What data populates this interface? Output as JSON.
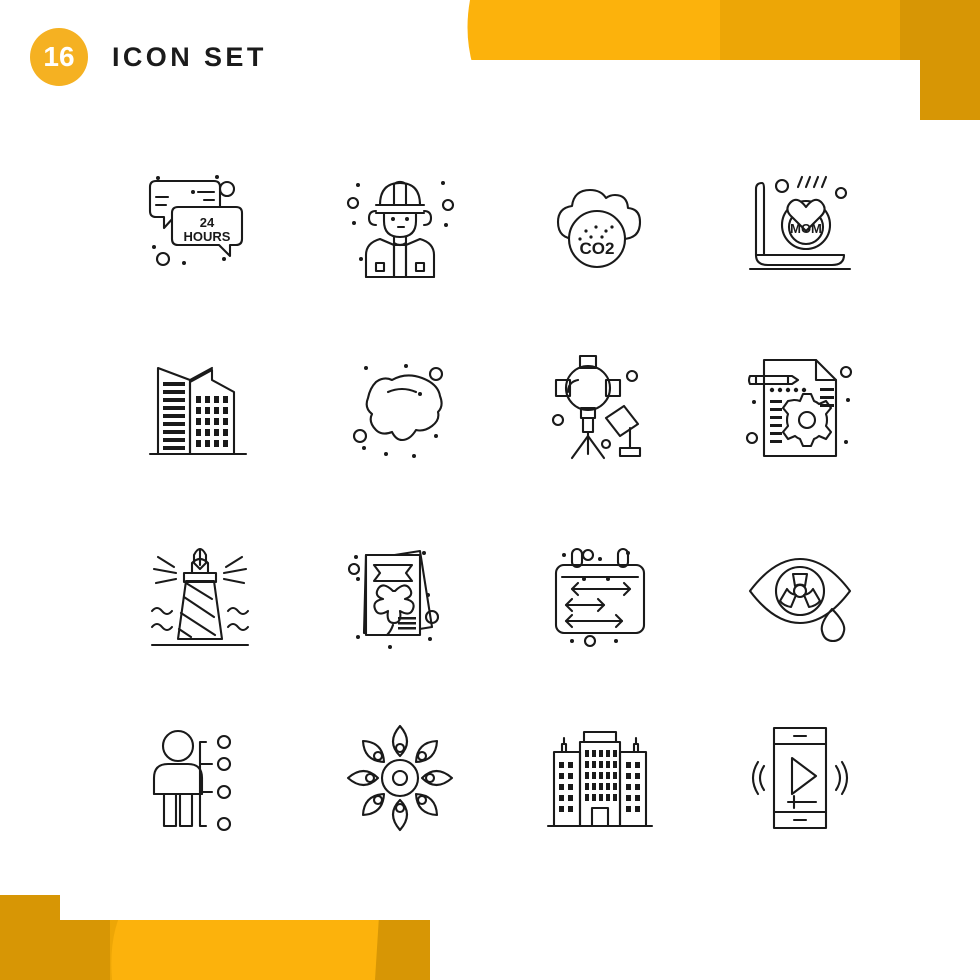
{
  "page": {
    "background_color": "#ffffff",
    "card_color": "#ffffff"
  },
  "header": {
    "count": "16",
    "title": "ICON SET",
    "badge_color": "#F5B122",
    "badge_text_color": "#ffffff",
    "title_color": "#1b1b1b"
  },
  "decoration": {
    "banner_light": "#FCB20C",
    "banner_mid": "#EDA606",
    "banner_dark": "#D79605",
    "top_right_name": "top-right-ribbon",
    "bottom_left_name": "bottom-left-ribbon"
  },
  "icon_style": {
    "stroke_color": "#1a1a1a",
    "stroke_width": "2.1",
    "fill": "none"
  },
  "grid": {
    "columns": 4,
    "rows": 4,
    "total": 16
  },
  "icons": [
    {
      "index": 1,
      "name": "24-hours-chat-support-icon",
      "label": "24 HOURS",
      "text_line1": "24",
      "text_line2": "HOURS"
    },
    {
      "index": 2,
      "name": "construction-worker-icon",
      "label": "Engineer"
    },
    {
      "index": 3,
      "name": "co2-cloud-icon",
      "label": "CO2",
      "text": "CO2"
    },
    {
      "index": 4,
      "name": "mothers-day-laptop-icon",
      "label": "MOM",
      "text": "MOM"
    },
    {
      "index": 5,
      "name": "skyscraper-buildings-icon",
      "label": "Skyscrapers"
    },
    {
      "index": 6,
      "name": "stain-blob-icon",
      "label": "Stain"
    },
    {
      "index": 7,
      "name": "studio-light-tripod-icon",
      "label": "Studio Light"
    },
    {
      "index": 8,
      "name": "document-settings-gear-icon",
      "label": "Document Settings"
    },
    {
      "index": 9,
      "name": "lighthouse-pen-icon",
      "label": "Lighthouse"
    },
    {
      "index": 10,
      "name": "clover-flyer-icon",
      "label": "Flyers"
    },
    {
      "index": 11,
      "name": "measurement-board-icon",
      "label": "Measure Board"
    },
    {
      "index": 12,
      "name": "eye-radiation-tear-icon",
      "label": "Eye Hazard"
    },
    {
      "index": 13,
      "name": "person-skills-list-icon",
      "label": "Person Skills"
    },
    {
      "index": 14,
      "name": "rangoli-flower-icon",
      "label": "Rangoli"
    },
    {
      "index": 15,
      "name": "office-building-icon",
      "label": "Office Building"
    },
    {
      "index": 16,
      "name": "smartphone-media-player-icon",
      "label": "Mobile Media"
    }
  ]
}
